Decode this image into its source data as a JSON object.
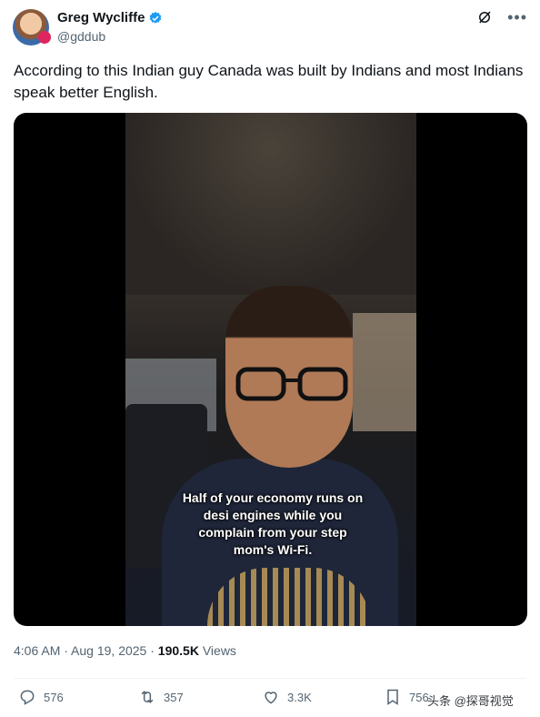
{
  "author": {
    "name": "Greg Wycliffe",
    "handle": "@gddub"
  },
  "tweet": {
    "text": "According to this Indian guy Canada was built by Indians and most Indians speak better English."
  },
  "media": {
    "caption": "Half of your economy runs on desi engines while you complain from your step mom's Wi-Fi."
  },
  "meta": {
    "time": "4:06 AM",
    "separator1": " · ",
    "date": "Aug 19, 2025",
    "separator2": " · ",
    "views_count": "190.5K",
    "views_label": " Views"
  },
  "actions": {
    "replies": "576",
    "reposts": "357",
    "likes": "3.3K",
    "bookmarks": "756"
  },
  "watermark": "头条 @探哥视觉",
  "colors": {
    "verified": "#1d9bf0",
    "text_secondary": "#536471"
  }
}
